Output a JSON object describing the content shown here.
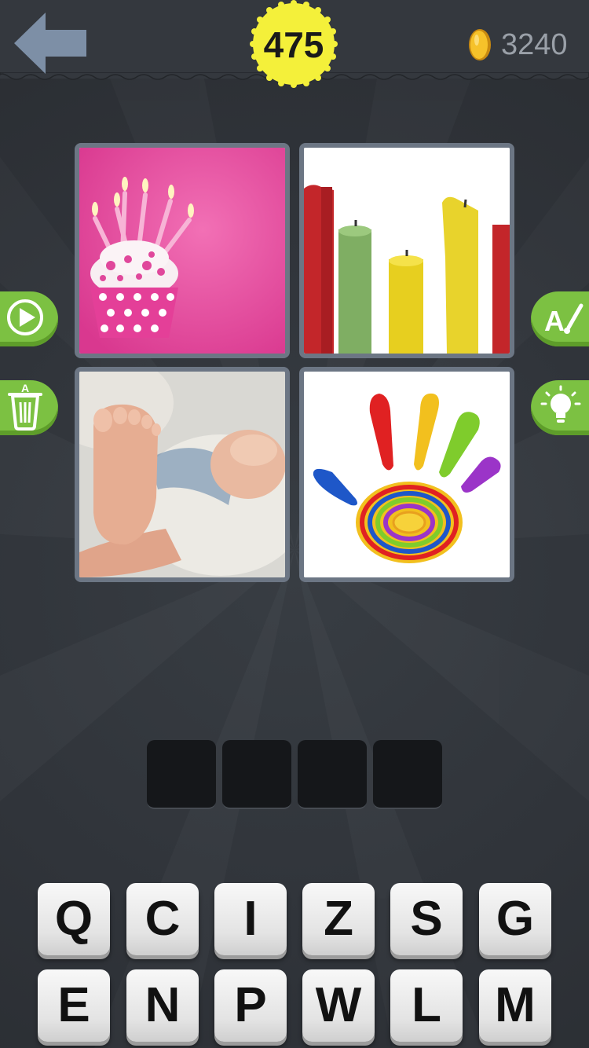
{
  "header": {
    "back_icon": "back-arrow-icon",
    "level": "475",
    "coin_icon": "gold-coin-icon",
    "coins": "3240"
  },
  "pictures": [
    {
      "subject": "cupcake-with-birthday-candles"
    },
    {
      "subject": "melting-colored-candles"
    },
    {
      "subject": "baby-feet"
    },
    {
      "subject": "colorful-painted-hand"
    }
  ],
  "side_buttons": {
    "left": [
      {
        "icon": "play-icon"
      },
      {
        "icon": "trash-remove-letters-icon"
      }
    ],
    "right": [
      {
        "icon": "reveal-letter-brush-icon"
      },
      {
        "icon": "lightbulb-hint-icon"
      }
    ]
  },
  "answer": {
    "slots": [
      "",
      "",
      "",
      ""
    ]
  },
  "keyboard": {
    "rows": [
      [
        "Q",
        "C",
        "I",
        "Z",
        "S",
        "G"
      ],
      [
        "E",
        "N",
        "P",
        "W",
        "L",
        "M"
      ]
    ]
  },
  "colors": {
    "background": "#2f3338",
    "accent_green": "#7cc142",
    "badge_yellow": "#f4f03a",
    "frame": "#6c7684"
  }
}
